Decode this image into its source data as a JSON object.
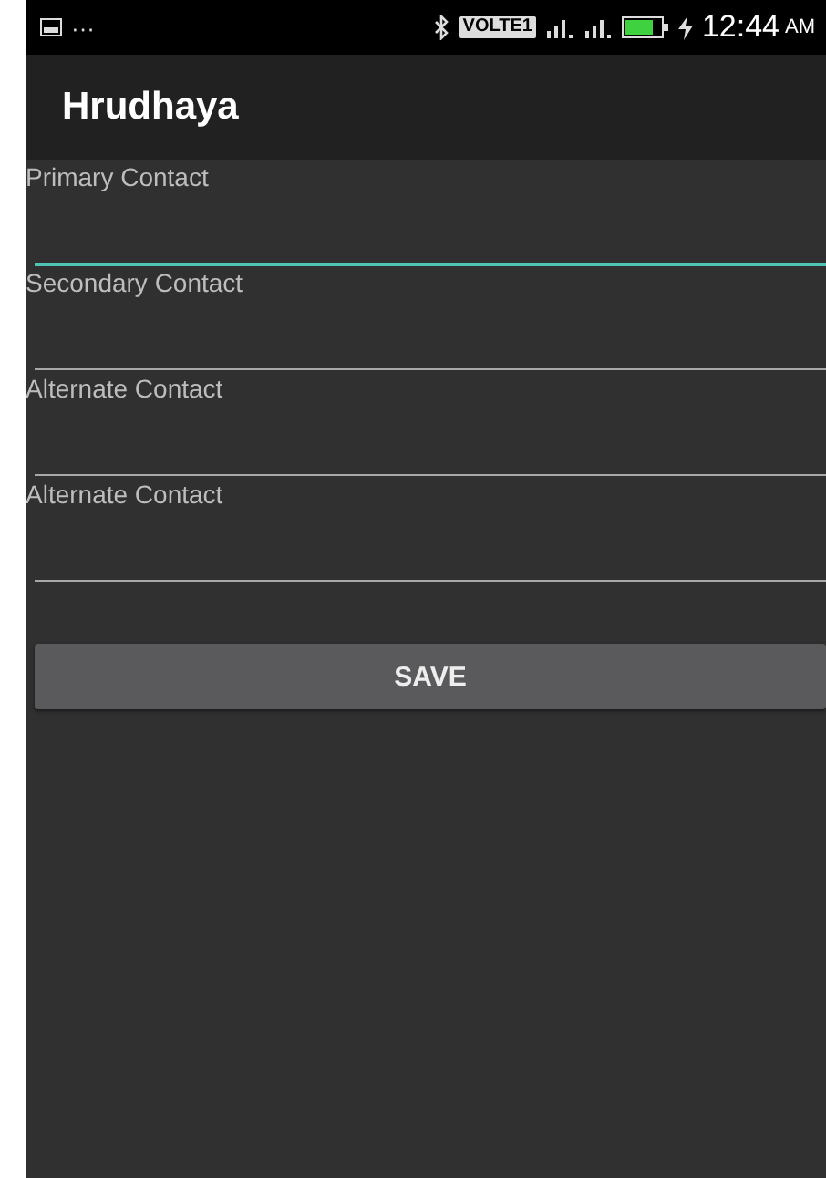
{
  "status_bar": {
    "dots": "···",
    "network_badge": "VOLTE1",
    "time": "12:44",
    "meridiem": "AM"
  },
  "app_bar": {
    "title": "Hrudhaya"
  },
  "fields": [
    {
      "label": "Primary Contact",
      "focused": true
    },
    {
      "label": "Secondary Contact",
      "focused": false
    },
    {
      "label": "Alternate Contact",
      "focused": false
    },
    {
      "label": "Alternate Contact",
      "focused": false
    }
  ],
  "buttons": [
    "SAVE"
  ]
}
